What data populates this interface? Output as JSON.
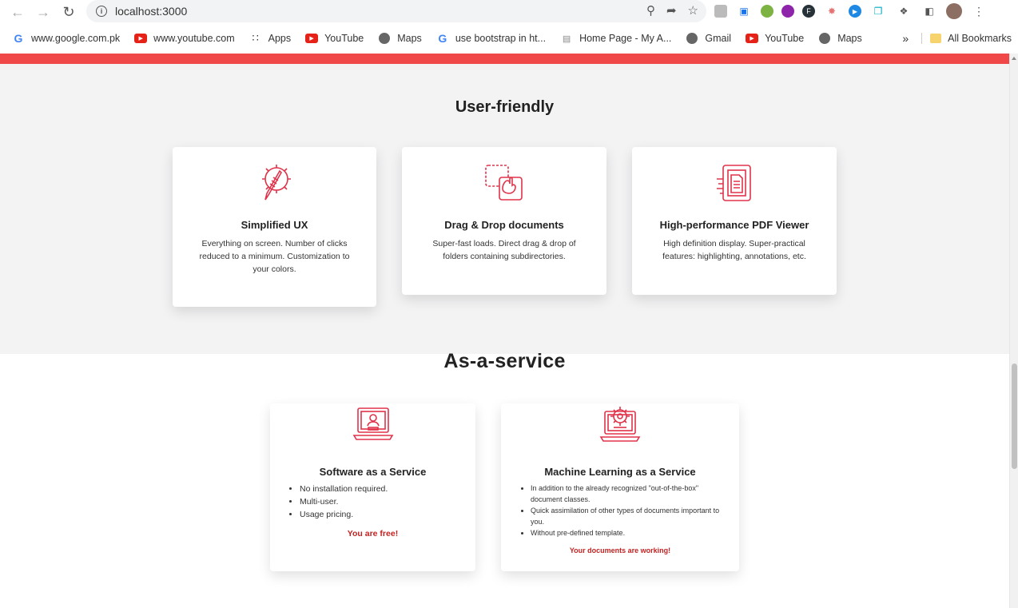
{
  "browser": {
    "url": "localhost:3000",
    "bookmarks": [
      {
        "label": "www.google.com.pk",
        "icon": "google-icon"
      },
      {
        "label": "www.youtube.com",
        "icon": "youtube-icon"
      },
      {
        "label": "Apps",
        "icon": "apps-grid-icon"
      },
      {
        "label": "YouTube",
        "icon": "youtube-icon"
      },
      {
        "label": "Maps",
        "icon": "globe-icon"
      },
      {
        "label": "use bootstrap in ht...",
        "icon": "google-icon"
      },
      {
        "label": "Home Page - My A...",
        "icon": "document-icon"
      },
      {
        "label": "Gmail",
        "icon": "globe-icon"
      },
      {
        "label": "YouTube",
        "icon": "youtube-icon"
      },
      {
        "label": "Maps",
        "icon": "globe-icon"
      }
    ],
    "more_label": "»",
    "all_bookmarks_label": "All Bookmarks"
  },
  "sections": {
    "user_friendly": {
      "title": "User-friendly",
      "cards": [
        {
          "title": "Simplified UX",
          "text": "Everything on screen. Number of clicks reduced to a minimum. Customization to your colors.",
          "icon": "pencil-gear-icon"
        },
        {
          "title": "Drag & Drop documents",
          "text": "Super-fast loads. Direct drag & drop of folders containing subdirectories.",
          "icon": "drag-drop-icon"
        },
        {
          "title": "High-performance PDF Viewer",
          "text": "High definition display. Super-practical features: highlighting, annotations, etc.",
          "icon": "pdf-viewer-icon"
        }
      ]
    },
    "as_a_service": {
      "title": "As-a-service",
      "cards": [
        {
          "title": "Software as a Service",
          "items": [
            "No installation required.",
            "Multi-user.",
            "Usage pricing."
          ],
          "tagline": "You are free!",
          "icon": "laptop-user-icon"
        },
        {
          "title": "Machine Learning as a Service",
          "items": [
            "In addition to the already recognized \"out-of-the-box\" document classes.",
            "Quick assimilation of other types of documents important to you.",
            "Without pre-defined template."
          ],
          "tagline": "Your documents are working!",
          "icon": "laptop-gear-icon"
        }
      ]
    }
  },
  "colors": {
    "accent": "#f04848",
    "icon_red": "#e0334a",
    "tagline_red": "#c42222",
    "section_bg": "#f3f3f4"
  }
}
